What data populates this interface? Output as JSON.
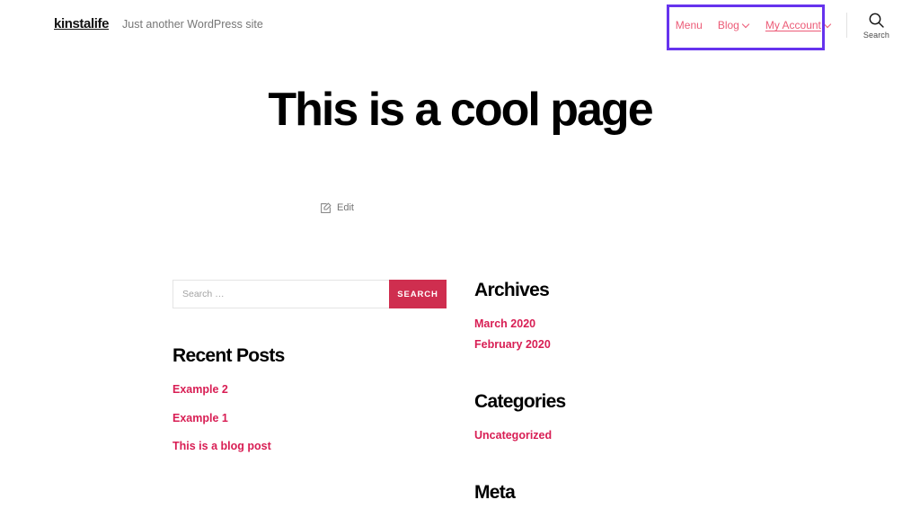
{
  "header": {
    "site_title": "kinstalife",
    "tagline": "Just another WordPress site",
    "nav": [
      {
        "label": "Menu",
        "has_dropdown": false,
        "current": false
      },
      {
        "label": "Blog",
        "has_dropdown": true,
        "current": false
      },
      {
        "label": "My Account",
        "has_dropdown": true,
        "current": true
      }
    ],
    "search_toggle_label": "Search",
    "highlight_color": "#6633ee"
  },
  "page": {
    "title": "This is a cool page",
    "edit_label": "Edit"
  },
  "widgets": {
    "search": {
      "placeholder": "Search …",
      "value": "",
      "button_label": "SEARCH"
    },
    "recent_posts": {
      "title": "Recent Posts",
      "items": [
        {
          "label": "Example 2"
        },
        {
          "label": "Example 1"
        },
        {
          "label": "This is a blog post"
        }
      ]
    },
    "archives": {
      "title": "Archives",
      "items": [
        {
          "label": "March 2020"
        },
        {
          "label": "February 2020"
        }
      ]
    },
    "categories": {
      "title": "Categories",
      "items": [
        {
          "label": "Uncategorized"
        }
      ]
    },
    "meta": {
      "title": "Meta"
    }
  },
  "colors": {
    "accent": "#d81e54",
    "button": "#cf2e4f",
    "nav_link": "#ec5b77",
    "highlight": "#6633ee",
    "muted": "#767676"
  }
}
